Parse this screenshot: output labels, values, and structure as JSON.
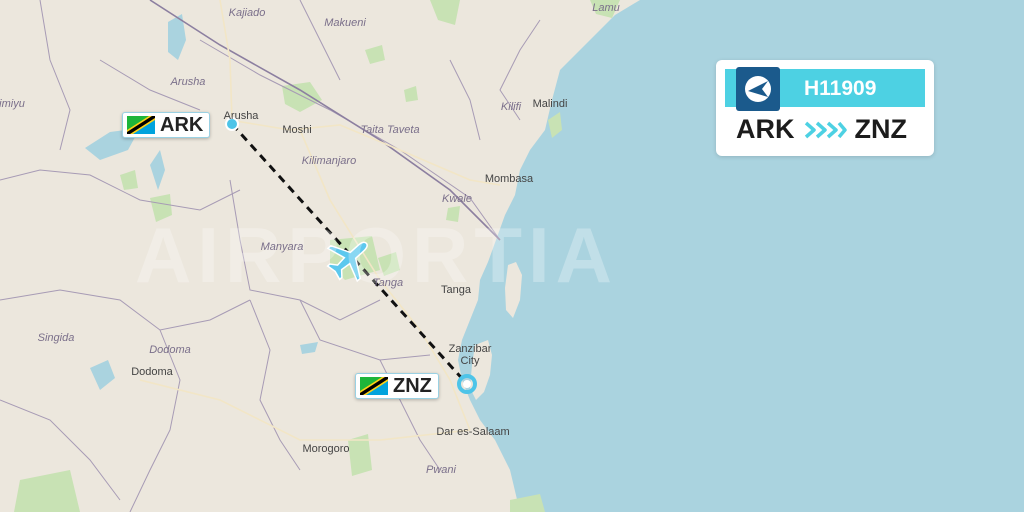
{
  "watermark": "AIRPORTIA",
  "flight": {
    "number": "H11909",
    "origin": "ARK",
    "destination": "ZNZ"
  },
  "airports": {
    "origin_label": "ARK",
    "destination_label": "ZNZ"
  },
  "places": [
    {
      "id": "kajiado",
      "label": "Kajiado",
      "type": "region"
    },
    {
      "id": "makueni",
      "label": "Makueni",
      "type": "region"
    },
    {
      "id": "lamu",
      "label": "Lamu",
      "type": "region"
    },
    {
      "id": "arusha-region",
      "label": "Arusha",
      "type": "region"
    },
    {
      "id": "arusha",
      "label": "Arusha",
      "type": "city"
    },
    {
      "id": "moshi",
      "label": "Moshi",
      "type": "city"
    },
    {
      "id": "kilifi",
      "label": "Kilifi",
      "type": "region"
    },
    {
      "id": "malindi",
      "label": "Malindi",
      "type": "city"
    },
    {
      "id": "taita-taveta",
      "label": "Taita Taveta",
      "type": "region"
    },
    {
      "id": "kilimanjaro",
      "label": "Kilimanjaro",
      "type": "region"
    },
    {
      "id": "mombasa",
      "label": "Mombasa",
      "type": "city"
    },
    {
      "id": "kwale",
      "label": "Kwale",
      "type": "region"
    },
    {
      "id": "manyara",
      "label": "Manyara",
      "type": "region"
    },
    {
      "id": "tanga-region",
      "label": "Tanga",
      "type": "region"
    },
    {
      "id": "tanga",
      "label": "Tanga",
      "type": "city"
    },
    {
      "id": "singida",
      "label": "Singida",
      "type": "region"
    },
    {
      "id": "dodoma-region",
      "label": "Dodoma",
      "type": "region"
    },
    {
      "id": "dodoma",
      "label": "Dodoma",
      "type": "city"
    },
    {
      "id": "zanzibar",
      "label": "Zanzibar City",
      "type": "city"
    },
    {
      "id": "dar",
      "label": "Dar es-Salaam",
      "type": "city"
    },
    {
      "id": "morogoro",
      "label": "Morogoro",
      "type": "city"
    },
    {
      "id": "pwani",
      "label": "Pwani",
      "type": "region"
    },
    {
      "id": "imiyu",
      "label": "imiyu",
      "type": "region"
    }
  ],
  "colors": {
    "land": "#ece7dd",
    "sea": "#aad3df",
    "park": "#c8e2b4",
    "border": "#a79bb5",
    "route": "#111111",
    "marker": "#4dc4e8",
    "banner": "#4dd1e3",
    "logo": "#1b5a8c"
  },
  "icons": {
    "plane": "plane-icon",
    "origin_flag": "tanzania-flag-icon",
    "destination_flag": "tanzania-flag-icon",
    "airline_logo": "airline-logo-icon",
    "route_arrows": "chevrons-right-icon"
  }
}
